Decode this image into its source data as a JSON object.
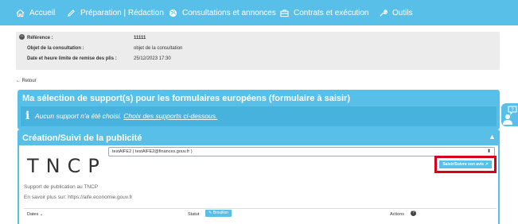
{
  "nav": {
    "home": "Accueil",
    "preparation": "Préparation | Rédaction",
    "consultations": "Consultations et annonces",
    "contrats": "Contrats et exécution",
    "outils": "Outils"
  },
  "info": {
    "reference_label": "Référence :",
    "reference_value": "11111",
    "objet_label": "Objet de la consultation :",
    "objet_value": "objet de la consultation",
    "date_label": "Date et heure limite de remise des plis :",
    "date_value": "25/12/2023 17:30"
  },
  "back": "← Retour",
  "panel1": {
    "title": "Ma sélection de support(s) pour les formulaires européens (formulaire à saisir)",
    "icon": "i",
    "text": "Aucun support n'a été choisi.",
    "link": "Choix des supports ci-dessous."
  },
  "panel2": {
    "title": "Création/Suivi de la publicité",
    "logo": "TNCP",
    "select_value": "testAIFE2 ( testAIFE2@finances.gouv.fr )",
    "saisir_button": "Saisir/Suivre son avis",
    "description": "Support de publication au TNCP",
    "link_text": "En savoir plus sur: https://aife.economie.gouv.fr",
    "table": {
      "dates": "Dates",
      "statut": "Statut",
      "badge": "Brouillon",
      "actions": "Actions"
    }
  }
}
